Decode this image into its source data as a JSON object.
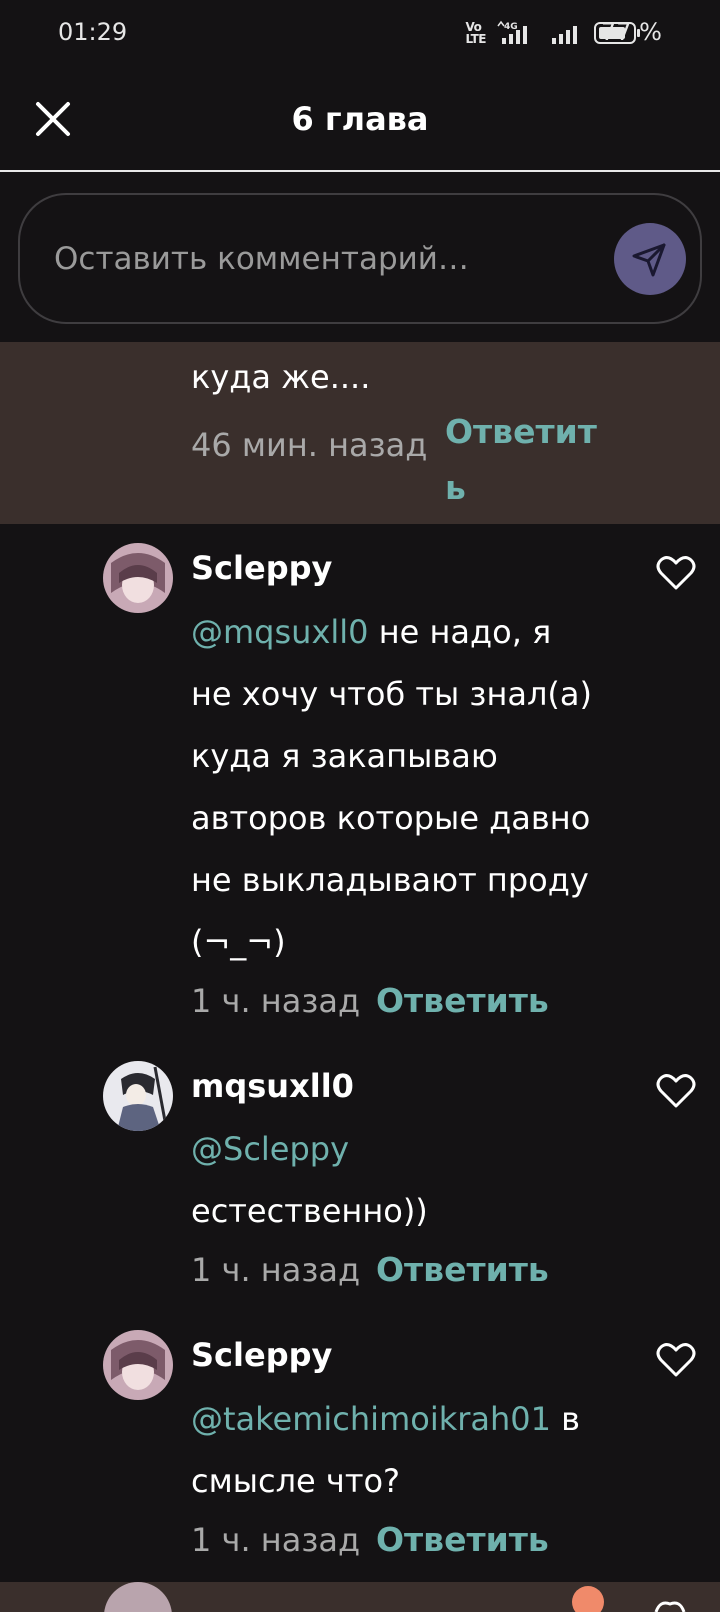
{
  "status_bar": {
    "time": "01:29",
    "network_label": "4G",
    "volte_label_top": "Vo",
    "volte_label_bottom": "LTE",
    "battery_percent": "77 %"
  },
  "header": {
    "title": "6 глава",
    "close_icon": "close-icon"
  },
  "comment_input": {
    "placeholder": "Оставить комментарий…",
    "value": "",
    "send_icon": "send-icon"
  },
  "highlighted_comment": {
    "text": "куда же....",
    "time": "46 мин. назад",
    "reply_line1": "Ответит",
    "reply_line2": "ь"
  },
  "comments": [
    {
      "username": "Scleppy",
      "mention": "@mqsuxll0",
      "lines": [
        "не надо, я",
        "не хочу чтоб ты знал(а)",
        "куда я закапываю",
        "авторов которые давно",
        "не выкладывают проду",
        "(¬_¬)"
      ],
      "time": "1 ч. назад",
      "reply": "Ответить"
    },
    {
      "username": "mqsuxll0",
      "mention": "@Scleppy",
      "lines": [
        "естественно))"
      ],
      "time": "1 ч. назад",
      "reply": "Ответить"
    },
    {
      "username": "Scleppy",
      "mention": "@takemichimoikrah01",
      "lines": [
        "в",
        "смысле что?"
      ],
      "time": "1 ч. назад",
      "reply": "Ответить"
    }
  ],
  "colors": {
    "background": "#141214",
    "highlight": "#3a2f2c",
    "accent": "#6fb1ad",
    "send_button": "#5f5a88"
  }
}
